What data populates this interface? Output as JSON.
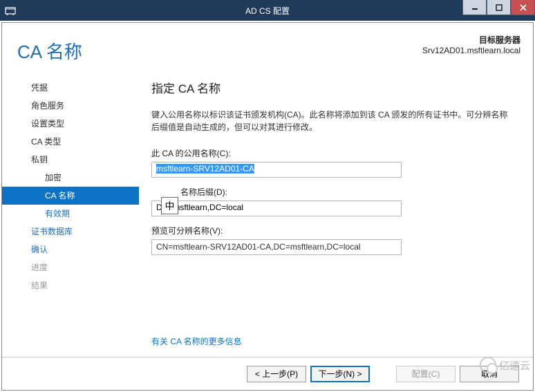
{
  "titlebar": {
    "title": "AD CS 配置"
  },
  "target": {
    "label": "目标服务器",
    "value": "Srv12AD01.msftlearn.local"
  },
  "page_title": "CA 名称",
  "sidebar": {
    "items": [
      {
        "label": "凭据"
      },
      {
        "label": "角色服务"
      },
      {
        "label": "设置类型"
      },
      {
        "label": "CA 类型"
      },
      {
        "label": "私钥"
      },
      {
        "label": "加密"
      },
      {
        "label": "CA 名称"
      },
      {
        "label": "有效期"
      },
      {
        "label": "证书数据库"
      },
      {
        "label": "确认"
      },
      {
        "label": "进度"
      },
      {
        "label": "结果"
      }
    ]
  },
  "main": {
    "heading": "指定 CA 名称",
    "description": "键入公用名称以标识该证书颁发机构(CA)。此名称将添加到该 CA 颁发的所有证书中。可分辨名称后缀值是自动生成的，但可以对其进行修改。",
    "common_name_label": "此 CA 的公用名称(C):",
    "common_name_value": "msftlearn-SRV12AD01-CA",
    "dn_suffix_label": "名称后缀(D):",
    "dn_suffix_value": "DC=msftlearn,DC=local",
    "preview_label": "预览可分辨名称(V):",
    "preview_value": "CN=msftlearn-SRV12AD01-CA,DC=msftlearn,DC=local",
    "more_link": "有关 CA 名称的更多信息",
    "ime": "中"
  },
  "buttons": {
    "prev": "< 上一步(P)",
    "next": "下一步(N) >",
    "configure": "配置(C)",
    "cancel": "取消"
  },
  "watermark": {
    "text": "亿速云"
  }
}
